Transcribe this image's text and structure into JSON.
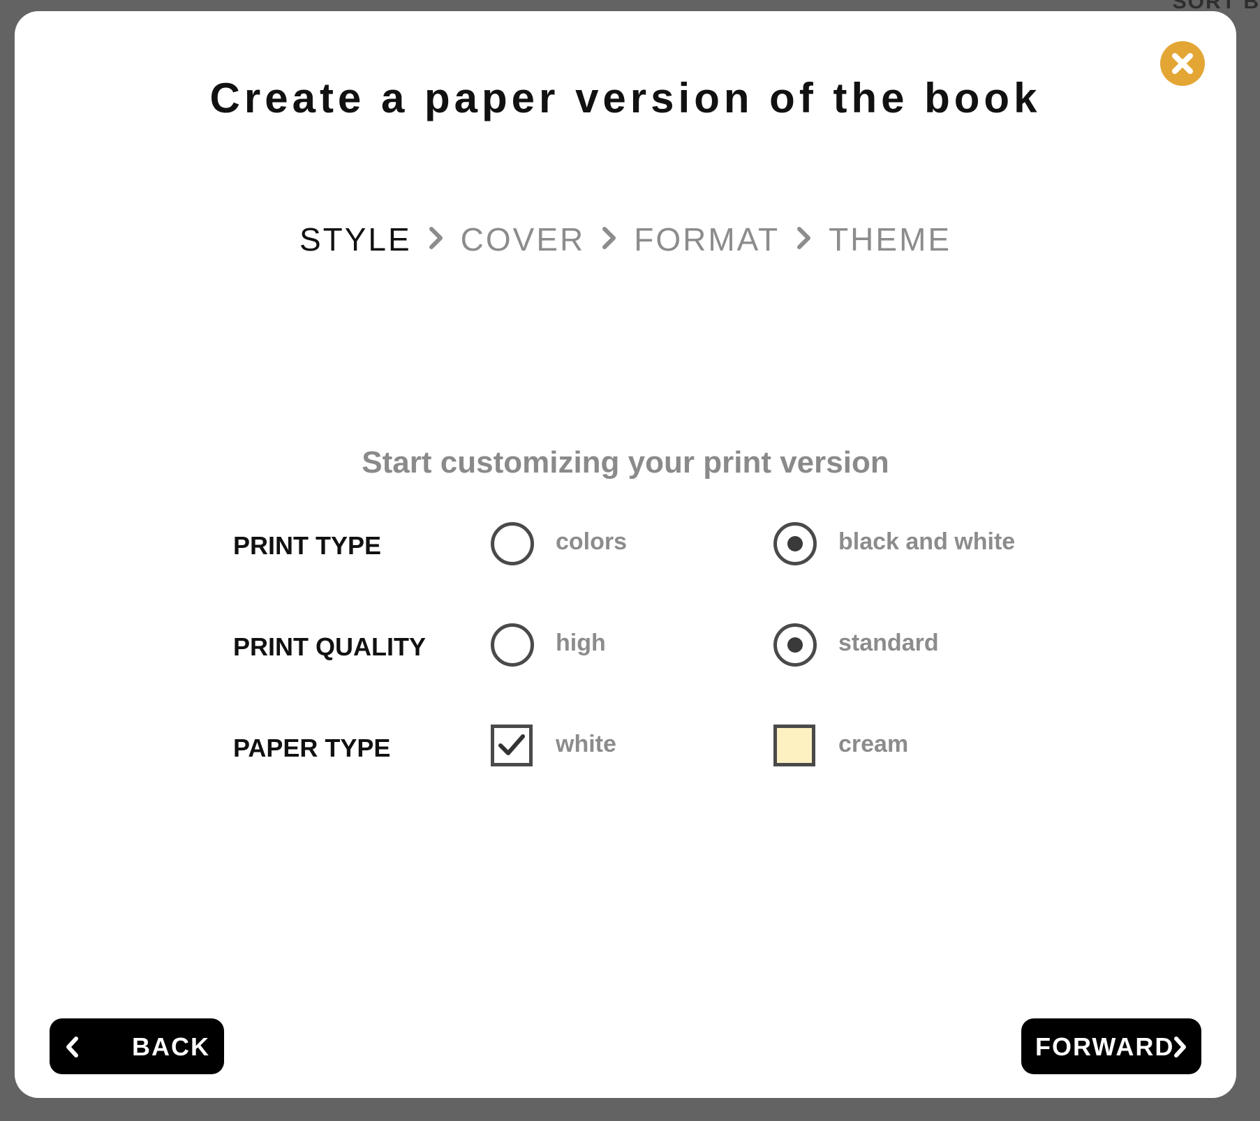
{
  "background": {
    "corner_text": "SORT B"
  },
  "modal": {
    "title": "Create a paper version of the book",
    "close_icon": "close-circle-icon",
    "accent_color": "#e3a635"
  },
  "steps": [
    {
      "label": "STYLE",
      "active": true
    },
    {
      "label": "COVER",
      "active": false
    },
    {
      "label": "FORMAT",
      "active": false
    },
    {
      "label": "THEME",
      "active": false
    }
  ],
  "subtitle": "Start customizing your print version",
  "options": {
    "print_type": {
      "label": "PRINT TYPE",
      "choices": [
        {
          "label": "colors",
          "selected": false
        },
        {
          "label": "black and white",
          "selected": true
        }
      ]
    },
    "print_quality": {
      "label": "PRINT QUALITY",
      "choices": [
        {
          "label": "high",
          "selected": false
        },
        {
          "label": "standard",
          "selected": true
        }
      ]
    },
    "paper_type": {
      "label": "PAPER TYPE",
      "choices": [
        {
          "label": "white",
          "selected": true,
          "color": "#ffffff"
        },
        {
          "label": "cream",
          "selected": false,
          "color": "#fdf1c2"
        }
      ]
    }
  },
  "nav": {
    "back_label": "BACK",
    "forward_label": "FORWARD"
  }
}
